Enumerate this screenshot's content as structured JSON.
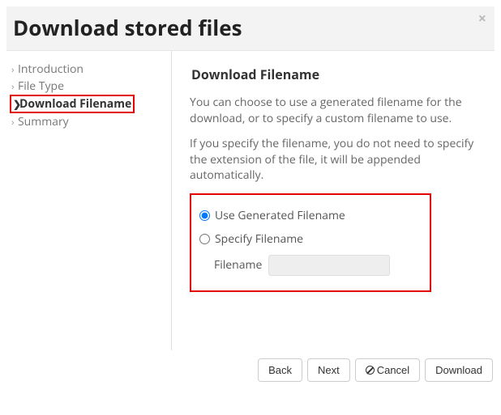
{
  "header": {
    "title": "Download stored files",
    "close": "×"
  },
  "sidebar": {
    "items": [
      {
        "label": "Introduction",
        "active": false
      },
      {
        "label": "File Type",
        "active": false
      },
      {
        "label": "Download Filename",
        "active": true
      },
      {
        "label": "Summary",
        "active": false
      }
    ]
  },
  "content": {
    "heading": "Download Filename",
    "para1": "You can choose to use a generated filename for the download, or to specify a custom filename to use.",
    "para2": "If you specify the filename, you do not need to specify the extension of the file, it will be appended automatically.",
    "options": {
      "use_generated": "Use Generated Filename",
      "specify": "Specify Filename",
      "selected": "use_generated",
      "filename_label": "Filename",
      "filename_value": ""
    }
  },
  "footer": {
    "back": "Back",
    "next": "Next",
    "cancel": "Cancel",
    "download": "Download"
  }
}
